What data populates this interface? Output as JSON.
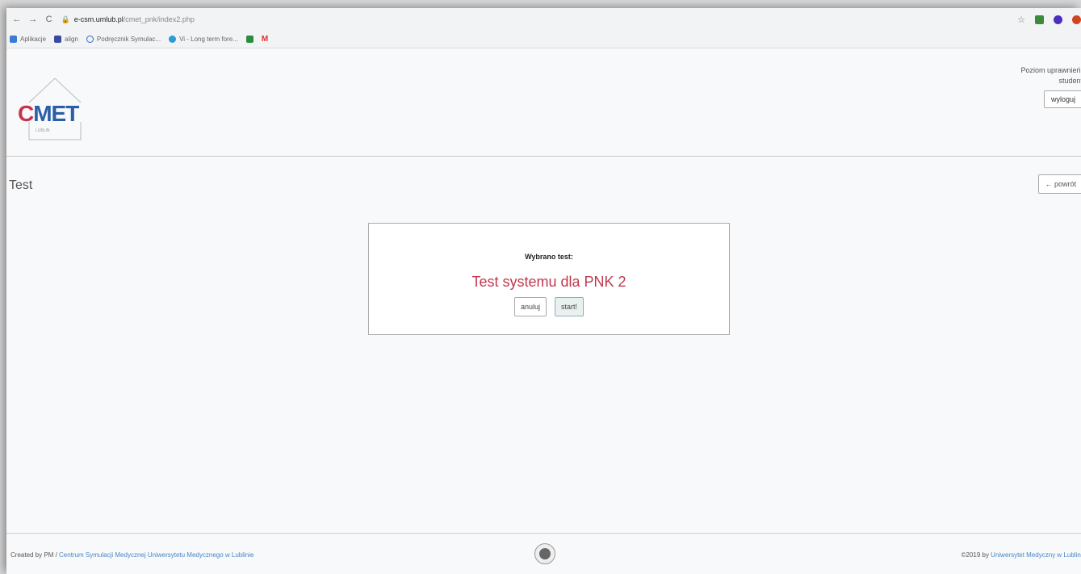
{
  "browser": {
    "back_icon": "arrow-left",
    "forward_icon": "arrow-right",
    "reload_icon": "reload",
    "url_host": "e-csm.umlub.pl",
    "url_path": "/cmet_pnk/index2.php",
    "bookmarks": [
      {
        "label": "Aplikacje",
        "icon_color": "#3b7bd6"
      },
      {
        "label": "align",
        "icon_color": "#3a4a9c"
      },
      {
        "label": "Podręcznik Symulac...",
        "icon_color": "#2b6bc8"
      },
      {
        "label": "Vi - Long term fore...",
        "icon_color": "#2a9bd6"
      },
      {
        "label": "",
        "icon_color": "#2d8a3e"
      },
      {
        "label": "M",
        "icon_color": "#d33"
      }
    ],
    "extension_colors": [
      "#3c8a3c",
      "#4b2fbf",
      "#d04520"
    ]
  },
  "header": {
    "logo_c": "C",
    "logo_met": "MET",
    "logo_subtext": "LUBLIN",
    "user_level": "Poziom uprawnień:",
    "user_role": "student",
    "logout_label": "wyloguj"
  },
  "main": {
    "page_title": "Test",
    "back_label": "← powrót",
    "card": {
      "label": "Wybrano test:",
      "test_name": "Test systemu dla PNK 2",
      "cancel_label": "anuluj",
      "start_label": "start!"
    }
  },
  "footer": {
    "created_by": "Created by PM / ",
    "centre_link": "Centrum Symulacji Medycznej Uniwersytetu Medycznego w Lublinie",
    "copyright": "©2019 by ",
    "university_link": "Uniwersytet Medyczny w Lublinie"
  },
  "colors": {
    "accent_red": "#c0394f",
    "link_blue": "#4a84c4"
  }
}
